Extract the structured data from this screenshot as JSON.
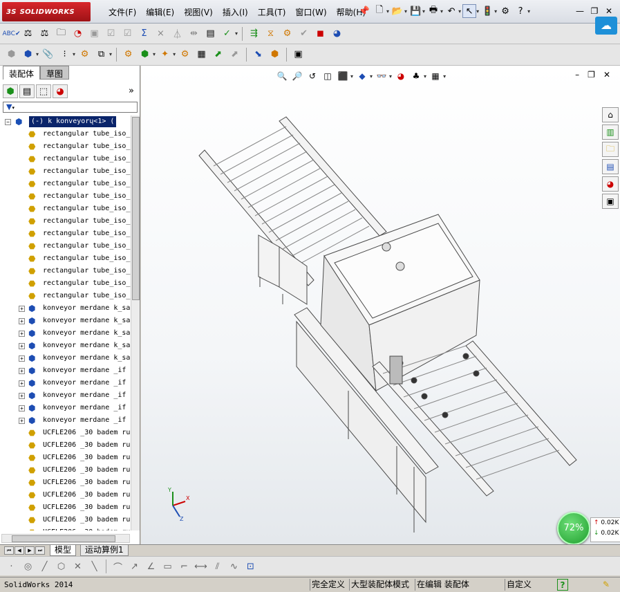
{
  "app": {
    "logo_text": "SOLIDWORKS",
    "logo_prefix": "3S"
  },
  "menu": [
    "文件(F)",
    "编辑(E)",
    "视图(V)",
    "插入(I)",
    "工具(T)",
    "窗口(W)",
    "帮助(H)"
  ],
  "window_controls": {
    "minimize": "—",
    "restore": "❐",
    "close": "✕"
  },
  "panel": {
    "tabs": [
      "装配体",
      "草图"
    ],
    "collapse_label": "»",
    "filter_icon": "filter-icon",
    "root_label": "(-)    k    konveyorų<1> (",
    "items": [
      {
        "label": "rectangular tube_iso_",
        "expandable": false,
        "icon": "part"
      },
      {
        "label": "rectangular tube_iso_",
        "expandable": false,
        "icon": "part"
      },
      {
        "label": "rectangular tube_iso_",
        "expandable": false,
        "icon": "part"
      },
      {
        "label": "rectangular tube_iso_",
        "expandable": false,
        "icon": "part"
      },
      {
        "label": "rectangular tube_iso_",
        "expandable": false,
        "icon": "part"
      },
      {
        "label": "rectangular tube_iso_",
        "expandable": false,
        "icon": "part"
      },
      {
        "label": "rectangular tube_iso_",
        "expandable": false,
        "icon": "part"
      },
      {
        "label": "rectangular tube_iso_",
        "expandable": false,
        "icon": "part"
      },
      {
        "label": "rectangular tube_iso_",
        "expandable": false,
        "icon": "part"
      },
      {
        "label": "rectangular tube_iso_",
        "expandable": false,
        "icon": "part"
      },
      {
        "label": "rectangular tube_iso_",
        "expandable": false,
        "icon": "part"
      },
      {
        "label": "rectangular tube_iso_",
        "expandable": false,
        "icon": "part"
      },
      {
        "label": "rectangular tube_iso_",
        "expandable": false,
        "icon": "part"
      },
      {
        "label": "rectangular tube_iso_",
        "expandable": false,
        "icon": "part"
      },
      {
        "label": "konveyor merdane k_sa",
        "expandable": true,
        "icon": "assembly"
      },
      {
        "label": "konveyor merdane k_sa",
        "expandable": true,
        "icon": "assembly"
      },
      {
        "label": "konveyor merdane k_sa",
        "expandable": true,
        "icon": "assembly"
      },
      {
        "label": "konveyor merdane k_sa",
        "expandable": true,
        "icon": "assembly"
      },
      {
        "label": "konveyor merdane k_sa",
        "expandable": true,
        "icon": "assembly"
      },
      {
        "label": "konveyor merdane _if",
        "expandable": true,
        "icon": "assembly"
      },
      {
        "label": "konveyor merdane _if",
        "expandable": true,
        "icon": "assembly"
      },
      {
        "label": "konveyor merdane _if",
        "expandable": true,
        "icon": "assembly"
      },
      {
        "label": "konveyor merdane _if",
        "expandable": true,
        "icon": "assembly"
      },
      {
        "label": "konveyor merdane _if",
        "expandable": true,
        "icon": "assembly"
      },
      {
        "label": "UCFLE206 _30 badem ru",
        "expandable": false,
        "icon": "part"
      },
      {
        "label": "UCFLE206 _30 badem ru",
        "expandable": false,
        "icon": "part"
      },
      {
        "label": "UCFLE206 _30 badem ru",
        "expandable": false,
        "icon": "part"
      },
      {
        "label": "UCFLE206 _30 badem ru",
        "expandable": false,
        "icon": "part"
      },
      {
        "label": "UCFLE206 _30 badem ru",
        "expandable": false,
        "icon": "part"
      },
      {
        "label": "UCFLE206 _30 badem ru",
        "expandable": false,
        "icon": "part"
      },
      {
        "label": "UCFLE206 _30 badem ru",
        "expandable": false,
        "icon": "part"
      },
      {
        "label": "UCFLE206 _30 badem ru",
        "expandable": false,
        "icon": "part"
      },
      {
        "label": "UCFLE206 _30 badem ru",
        "expandable": false,
        "icon": "part"
      }
    ]
  },
  "viewport": {
    "triad": {
      "x": "X",
      "y": "Y",
      "z": "Z"
    },
    "performance": "72%",
    "net_up": "0.02K",
    "net_down": "0.02K"
  },
  "bottom_tabs": [
    "模型",
    "运动算例1"
  ],
  "status": {
    "app_version": "SolidWorks 2014",
    "fully_defined": "完全定义",
    "large_assembly": "大型装配体模式",
    "editing": "在编辑 装配体",
    "custom": "自定义",
    "help": "?"
  },
  "colors": {
    "accent": "#0a246a",
    "logo": "#c8191e",
    "perf": "#2fb83d"
  }
}
